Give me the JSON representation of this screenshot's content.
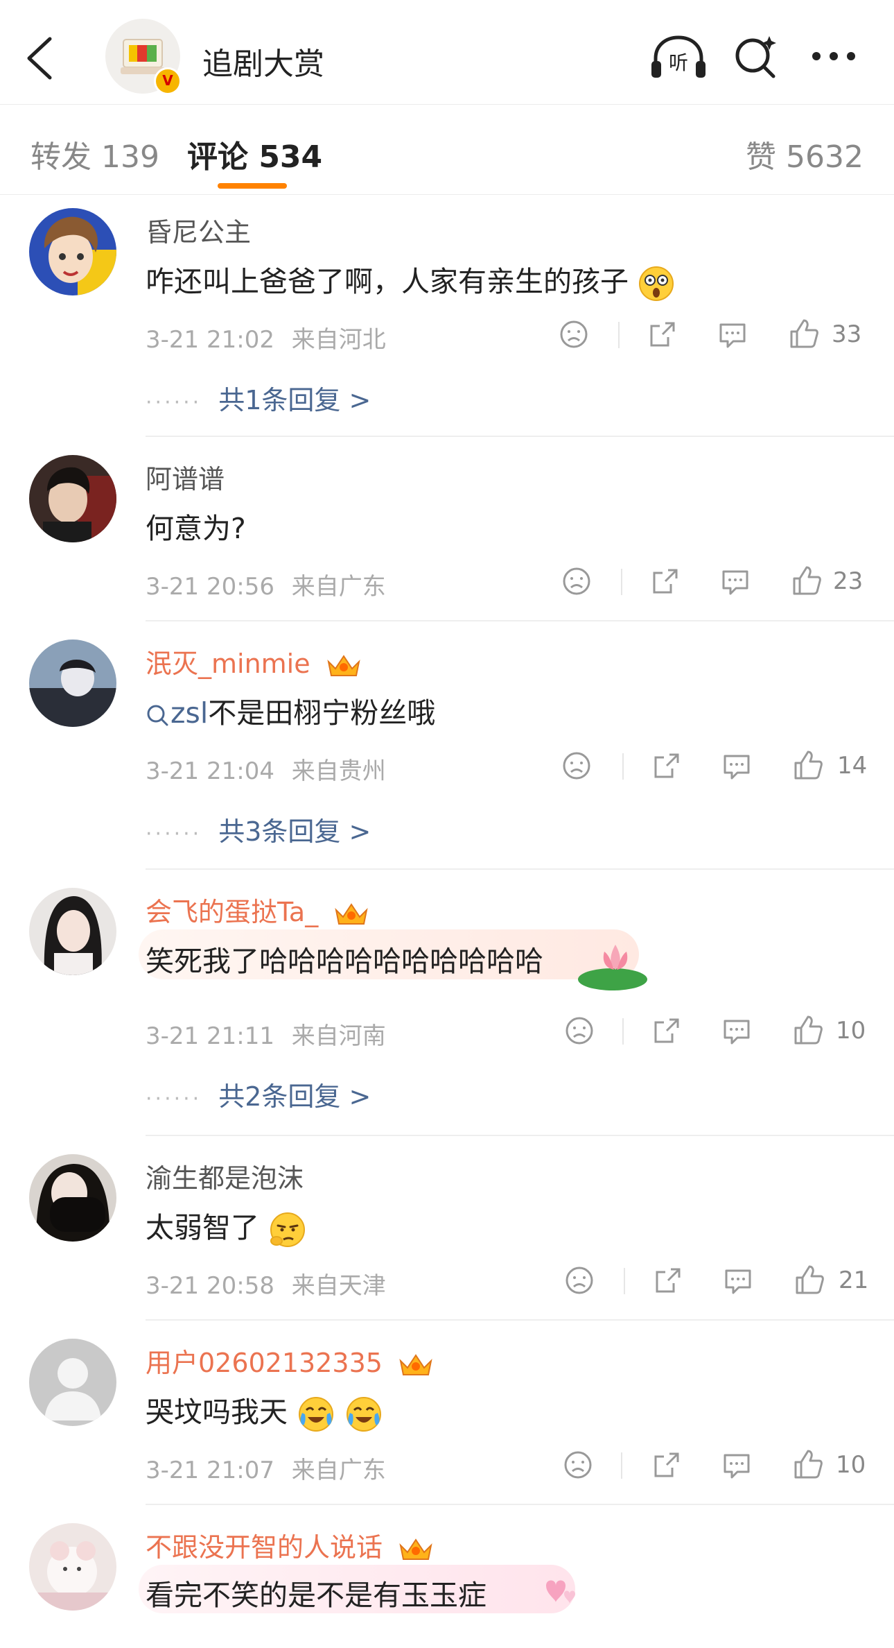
{
  "header": {
    "title": "追剧大赏",
    "verified_badge": "V"
  },
  "tabs": {
    "repost": "转发 139",
    "comments": "评论 534",
    "likes": "赞 5632"
  },
  "comments": [
    {
      "name": "昏尼公主",
      "text": "咋还叫上爸爸了啊，人家有亲生的孩子",
      "time": "3-21 21:02",
      "location": "来自河北",
      "likes": "33",
      "replies": "共1条回复 >"
    },
    {
      "name": "阿谱谱",
      "text": "何意为?",
      "time": "3-21 20:56",
      "location": "来自广东",
      "likes": "23"
    },
    {
      "name": "泯灭_minmie",
      "link": "zsl",
      "text": "不是田栩宁粉丝哦",
      "time": "3-21 21:04",
      "location": "来自贵州",
      "likes": "14",
      "replies": "共3条回复 >"
    },
    {
      "name": "会飞的蛋挞Ta_",
      "text": "笑死我了哈哈哈哈哈哈哈哈哈哈",
      "time": "3-21 21:11",
      "location": "来自河南",
      "likes": "10",
      "replies": "共2条回复 >"
    },
    {
      "name": "渝生都是泡沫",
      "text": "太弱智了",
      "time": "3-21 20:58",
      "location": "来自天津",
      "likes": "21"
    },
    {
      "name": "用户02602132335",
      "text": "哭坟吗我天",
      "time": "3-21 21:07",
      "location": "来自广东",
      "likes": "10"
    },
    {
      "name": "不跟没开智的人说话",
      "text": "看完不笑的是不是有玉玉症"
    }
  ],
  "reply_dots": "······",
  "colors": {
    "accent": "#ff8200",
    "vip_name": "#eb7350",
    "link": "#4a6791"
  }
}
